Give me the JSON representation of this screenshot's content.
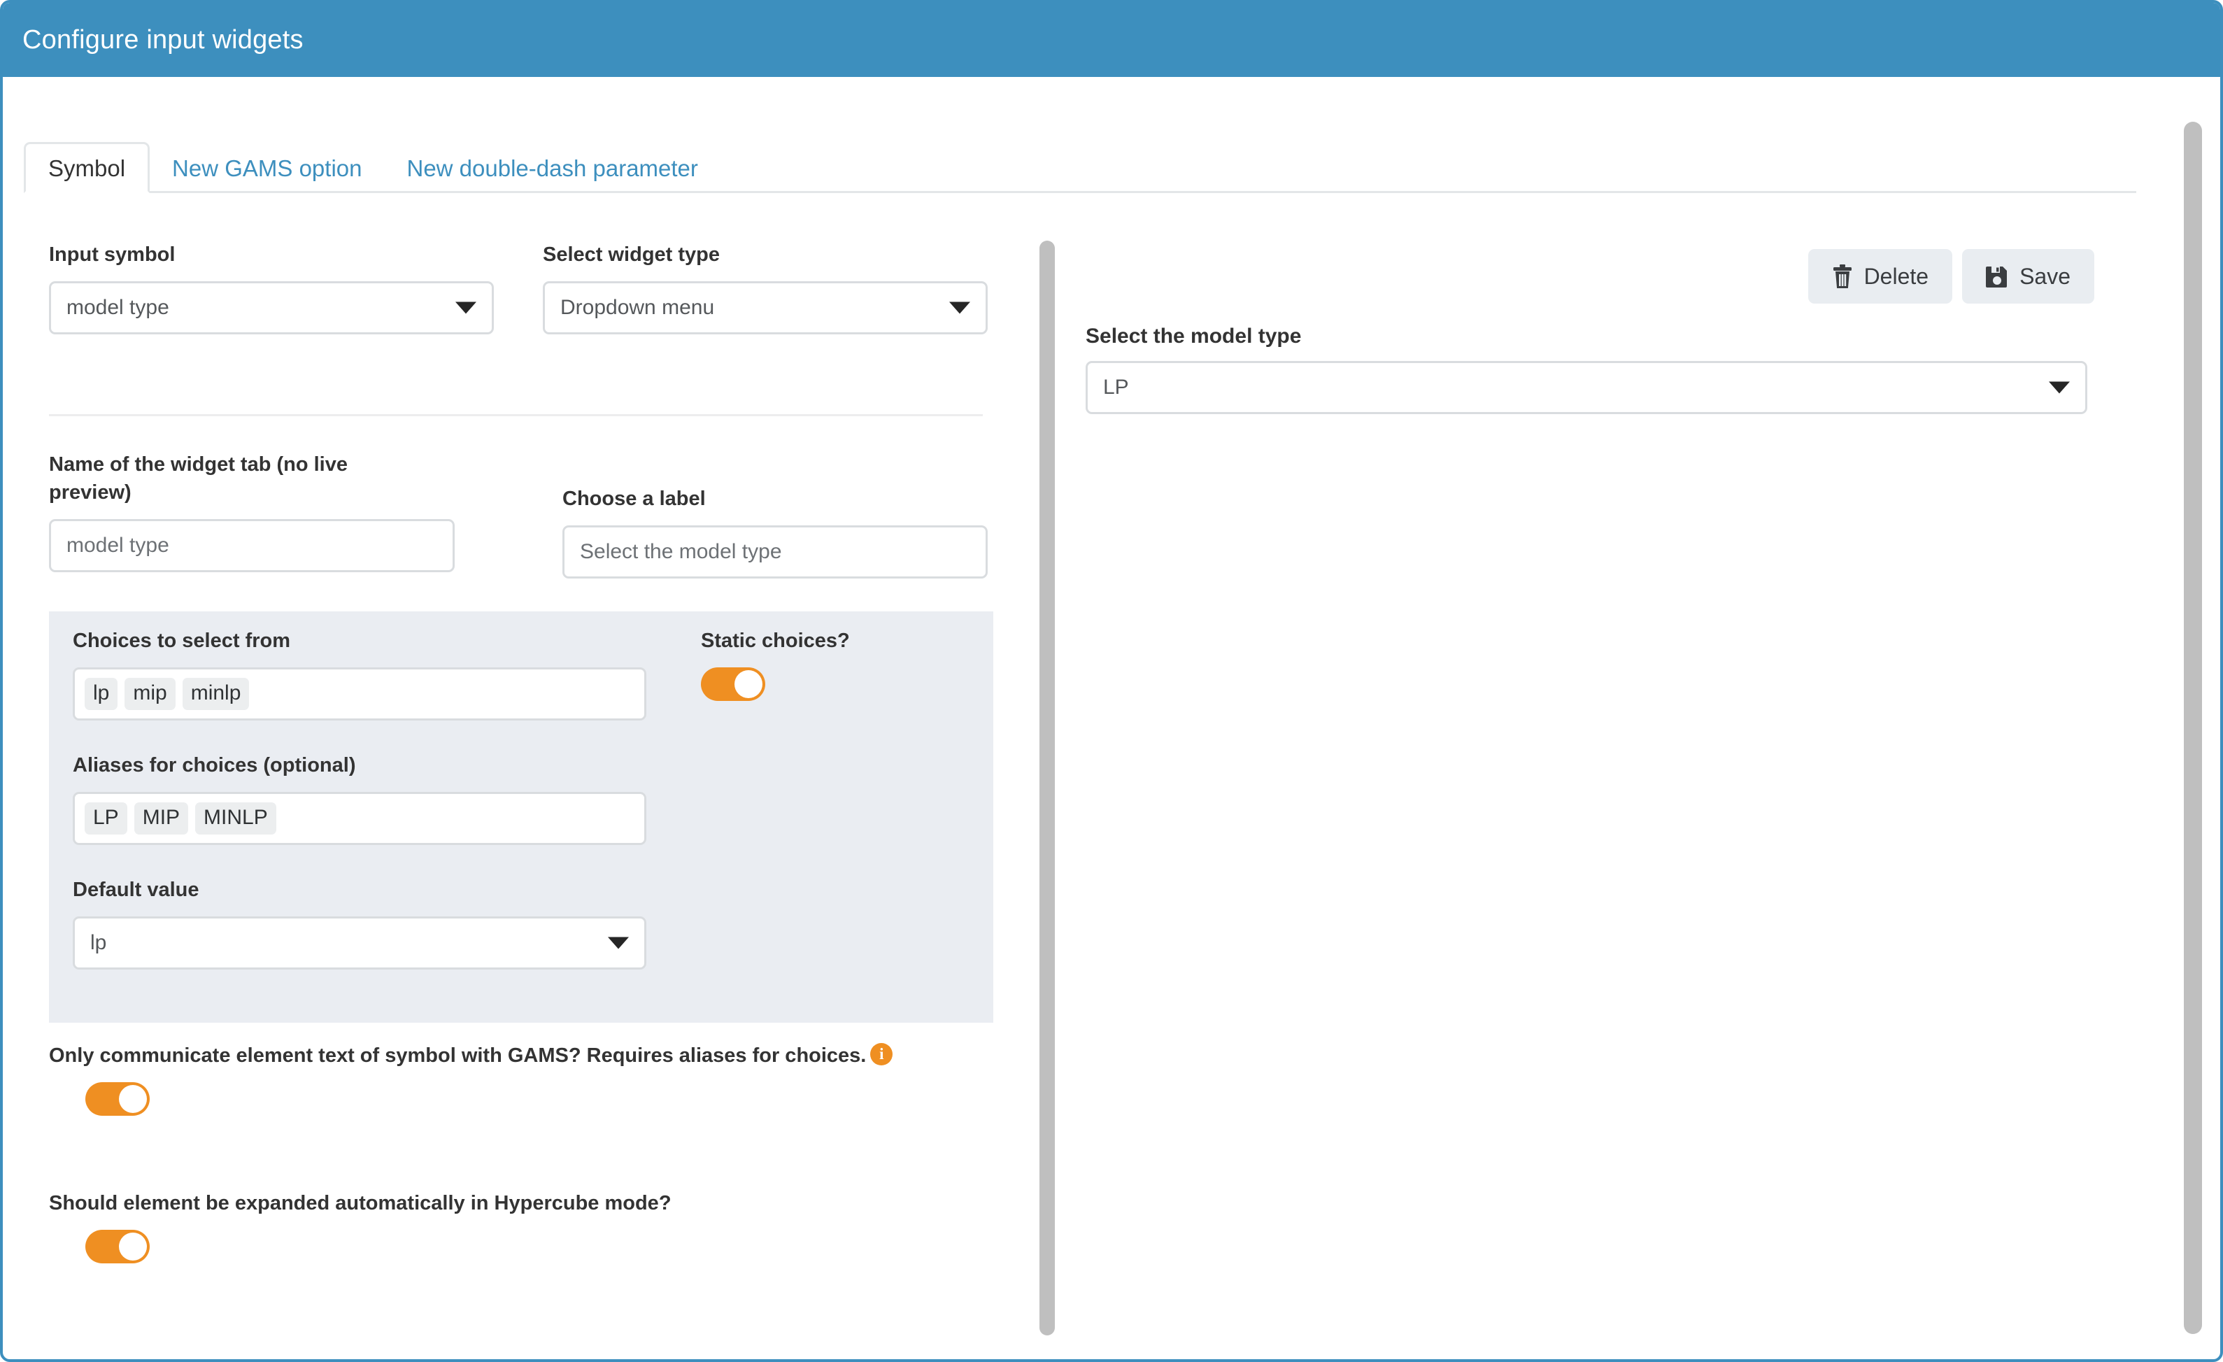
{
  "window": {
    "title": "Configure input widgets",
    "header_color": "#3d8fbe",
    "accent_color": "#ef8f22"
  },
  "tabs": [
    {
      "label": "Symbol",
      "active": true
    },
    {
      "label": "New GAMS option",
      "active": false
    },
    {
      "label": "New double-dash parameter",
      "active": false
    }
  ],
  "form": {
    "input_symbol": {
      "label": "Input symbol",
      "value": "model type"
    },
    "widget_type": {
      "label": "Select widget type",
      "value": "Dropdown menu"
    },
    "widget_tab_name": {
      "label": "Name of the widget tab (no live preview)",
      "value": "model type"
    },
    "choose_label": {
      "label": "Choose a label",
      "value": "Select the model type"
    },
    "choices": {
      "label": "Choices to select from",
      "chips": [
        "lp",
        "mip",
        "minlp"
      ]
    },
    "static_choices": {
      "label": "Static choices?",
      "state": "on"
    },
    "aliases": {
      "label": "Aliases for choices (optional)",
      "chips": [
        "LP",
        "MIP",
        "MINLP"
      ]
    },
    "default_value": {
      "label": "Default value",
      "value": "lp"
    },
    "element_text_only": {
      "label": "Only communicate element text of symbol with GAMS? Requires aliases for choices.",
      "info_glyph": "i",
      "state": "on"
    },
    "hypercube_expand": {
      "label": "Should element be expanded automatically in Hypercube mode?",
      "state": "on"
    }
  },
  "toolbar": {
    "delete_label": "Delete",
    "save_label": "Save"
  },
  "preview": {
    "label": "Select the model type",
    "value": "LP"
  }
}
